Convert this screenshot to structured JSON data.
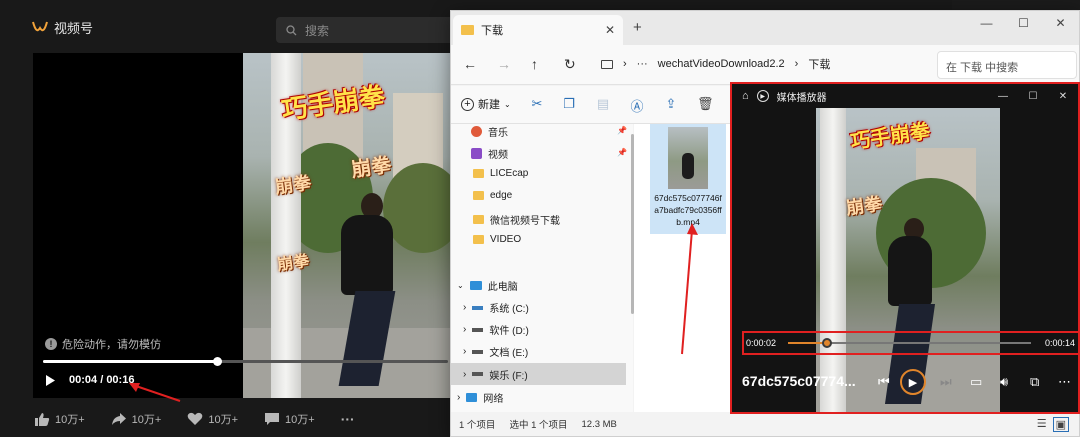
{
  "wechat": {
    "app_name": "视频号",
    "search_placeholder": "搜索",
    "overlay_title": "巧手崩拳",
    "overlay_word": "崩拳",
    "warning": "危险动作，请勿模仿",
    "time_current": "00:04",
    "time_sep": " / ",
    "time_total": "00:16",
    "progress_fraction": 0.43,
    "actions": [
      {
        "icon": "thumbs-up-icon",
        "count": "10万+"
      },
      {
        "icon": "share-icon",
        "count": "10万+"
      },
      {
        "icon": "heart-icon",
        "count": "10万+"
      },
      {
        "icon": "comment-icon",
        "count": "10万+"
      }
    ],
    "more": "···"
  },
  "explorer": {
    "tab_title": "下载",
    "new_tab": "+",
    "breadcrumb": [
      "wechatVideoDownload2.2",
      "下载"
    ],
    "breadcrumb_more": "···",
    "search_placeholder": "在 下载 中搜索",
    "toolbar_new": "新建",
    "sidebar": [
      {
        "label": "音乐",
        "kind": "music",
        "pinned": true
      },
      {
        "label": "视频",
        "kind": "video",
        "pinned": true
      },
      {
        "label": "LICEcap",
        "kind": "folder"
      },
      {
        "label": "edge",
        "kind": "folder"
      },
      {
        "label": "微信视频号下载",
        "kind": "folder"
      },
      {
        "label": "VIDEO",
        "kind": "folder"
      },
      {
        "label": "此电脑",
        "kind": "pc"
      },
      {
        "label": "系统 (C:)",
        "kind": "drive"
      },
      {
        "label": "软件 (D:)",
        "kind": "drive"
      },
      {
        "label": "文档 (E:)",
        "kind": "drive"
      },
      {
        "label": "娱乐 (F:)",
        "kind": "drive",
        "selected": true
      },
      {
        "label": "网络",
        "kind": "network"
      }
    ],
    "file": {
      "name": "67dc575c077746fa7badfc79c0356ffb.mp4"
    },
    "status": {
      "count": "1 个项目",
      "selected": "选中 1 个项目",
      "size": "12.3 MB"
    }
  },
  "player": {
    "title": "媒体播放器",
    "time_current": "0:00:02",
    "time_total": "0:00:14",
    "progress_fraction": 0.16,
    "filename": "67dc575c07774..."
  },
  "colors": {
    "highlight": "#e02020",
    "accent": "#e0852b"
  }
}
